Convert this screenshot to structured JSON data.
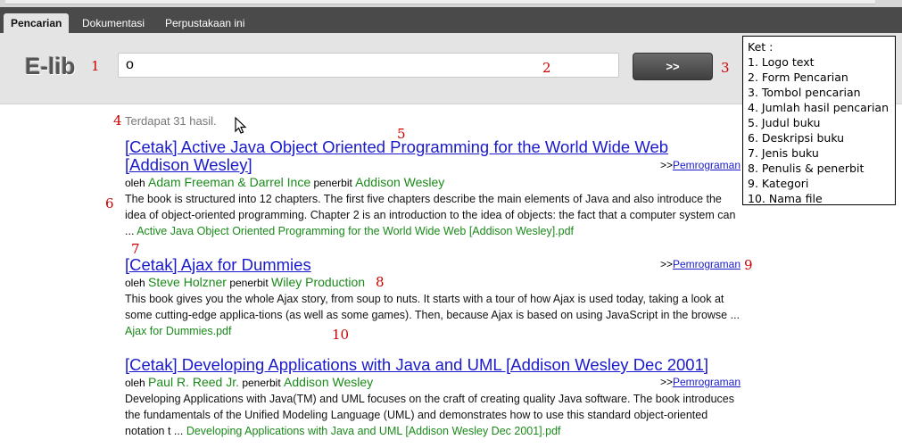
{
  "nav": {
    "tabs": [
      {
        "label": "Pencarian"
      },
      {
        "label": "Dokumentasi"
      },
      {
        "label": "Perpustakaan ini"
      }
    ]
  },
  "header": {
    "logo": "E-lib",
    "search_value": "o",
    "search_button": ">>"
  },
  "results": {
    "count_text": "Terdapat 31 hasil.",
    "items": [
      {
        "title_line1": "[Cetak] Active Java Object Oriented Programming for the World Wide Web",
        "title_line2": "[Addison Wesley]",
        "category_prefix": ">>",
        "category": "Pemrograman",
        "by_label": "oleh",
        "author": "Adam Freeman & Darrel Ince",
        "publisher_label": "penerbit",
        "publisher": "Addison Wesley",
        "description": "The book is structured into 12 chapters. The first five chapters describe the main elements of Java and also introduce the idea of object-oriented programming. Chapter 2 is an introduction to the idea of objects: the fact that a computer system can ...",
        "file": "Active Java Object Oriented Programming for the World Wide Web [Addison Wesley].pdf"
      },
      {
        "title_line1": "[Cetak] Ajax for Dummies",
        "category_prefix": ">>",
        "category": "Pemrograman",
        "by_label": "oleh",
        "author": "Steve Holzner",
        "publisher_label": "penerbit",
        "publisher": "Wiley Production",
        "description": "This book gives you the whole Ajax story, from soup to nuts. It starts with a tour of how Ajax is used today, taking a look at some cutting-edge applica-tions (as well as some games). Then, because Ajax is based on using JavaScript in the browse ...",
        "file": "Ajax for Dummies.pdf"
      },
      {
        "title_line1": "[Cetak] Developing Applications with Java and UML [Addison Wesley Dec 2001]",
        "category_prefix": ">>",
        "category": "Pemrograman",
        "by_label": "oleh",
        "author": "Paul R. Reed Jr.",
        "publisher_label": "penerbit",
        "publisher": "Addison Wesley",
        "description": "Developing Applications with Java(TM) and UML focuses on the craft of creating quality Java software. The book introduces the fundamentals of the Unified Modeling Language (UML) and demonstrates how to use this standard object-oriented notation t ...",
        "file": "Developing Applications with Java and UML [Addison Wesley Dec 2001].pdf"
      }
    ]
  },
  "legend": {
    "title": "Ket :",
    "items": [
      "1. Logo text",
      "2. Form Pencarian",
      "3. Tombol pencarian",
      "4. Jumlah hasil pencarian",
      "5. Judul buku",
      "6. Deskripsi buku",
      "7. Jenis buku",
      "8. Penulis & penerbit",
      "9. Kategori",
      "10. Nama file"
    ]
  },
  "annotations": [
    "1",
    "2",
    "3",
    "4",
    "5",
    "6",
    "7",
    "8",
    "9",
    "10"
  ],
  "colors": {
    "navbar": "#4a4a4a",
    "header": "#e4e4e4",
    "link": "#1a1acc",
    "green": "#1a8a1a",
    "annotation": "#cc0000"
  }
}
